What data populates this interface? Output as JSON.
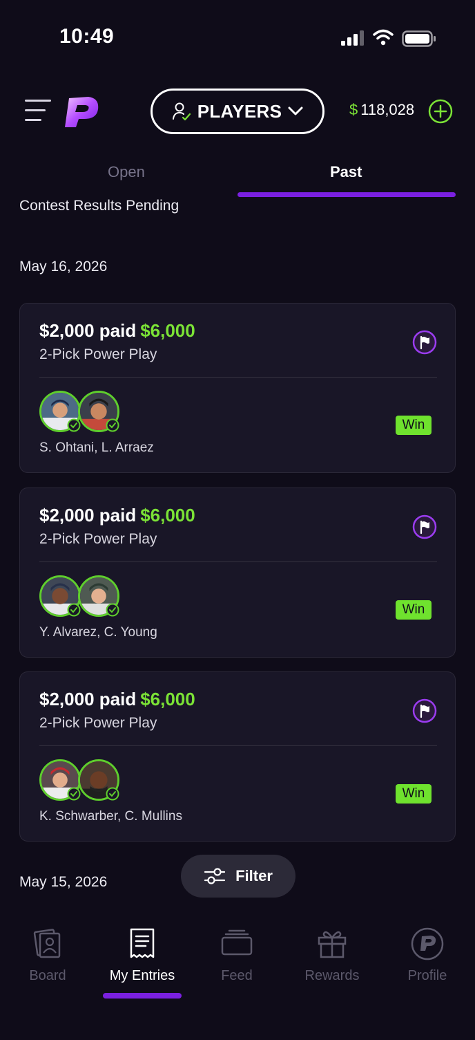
{
  "status_bar": {
    "time": "10:49"
  },
  "header": {
    "menu_icon": "hamburger-icon",
    "logo": "prizepicks-logo",
    "mode_button_label": "PLAYERS",
    "balance_symbol": "$",
    "balance_amount": "118,028",
    "add_funds_icon": "plus-circle-icon",
    "accent_green": "#7be236",
    "accent_purple": "#7a20e0"
  },
  "tabs": [
    {
      "label": "Open",
      "active": false
    },
    {
      "label": "Past",
      "active": true
    }
  ],
  "pending_text": "Contest Results Pending",
  "sections": [
    {
      "date": "May 16, 2026",
      "entries": [
        {
          "paid": "$2,000 paid",
          "won": "$6,000",
          "type": "2-Pick Power Play",
          "players": "S. Ohtani, L. Arraez",
          "result": "Win"
        },
        {
          "paid": "$2,000 paid",
          "won": "$6,000",
          "type": "2-Pick Power Play",
          "players": "Y. Alvarez, C. Young",
          "result": "Win"
        },
        {
          "paid": "$2,000 paid",
          "won": "$6,000",
          "type": "2-Pick Power Play",
          "players": "K. Schwarber, C. Mullins",
          "result": "Win"
        }
      ]
    },
    {
      "date": "May 15, 2026",
      "entries": []
    }
  ],
  "filter": {
    "label": "Filter",
    "icon": "sliders-icon"
  },
  "bottom_nav": [
    {
      "label": "Board",
      "icon": "board-icon",
      "active": false
    },
    {
      "label": "My Entries",
      "icon": "receipt-icon",
      "active": true
    },
    {
      "label": "Feed",
      "icon": "feed-icon",
      "active": false
    },
    {
      "label": "Rewards",
      "icon": "gift-icon",
      "active": false
    },
    {
      "label": "Profile",
      "icon": "profile-logo-icon",
      "active": false
    }
  ]
}
